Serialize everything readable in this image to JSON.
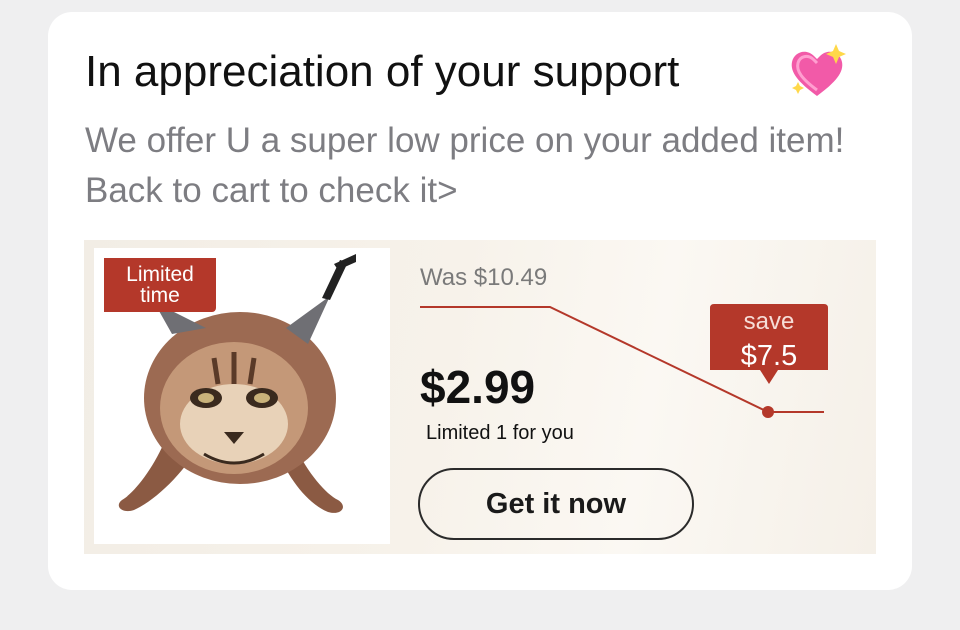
{
  "notification": {
    "title": "In appreciation of your support",
    "title_icon": "sparkling-heart-icon",
    "subtitle": "We offer U a super low price on your added item! Back to cart to check it>"
  },
  "offer": {
    "tag_label": "Limited time",
    "was_price": "Was $10.49",
    "save_label": "save",
    "save_amount": "$7.5",
    "current_price": "$2.99",
    "limit_note": "Limited 1 for you",
    "cta_label": "Get it now",
    "product_image": "plush-caracal-cat-toy"
  },
  "colors": {
    "accent_red": "#b4382a",
    "title_text": "#111111",
    "subtitle_text": "#7d7d82",
    "heart": "#f25aa8"
  }
}
